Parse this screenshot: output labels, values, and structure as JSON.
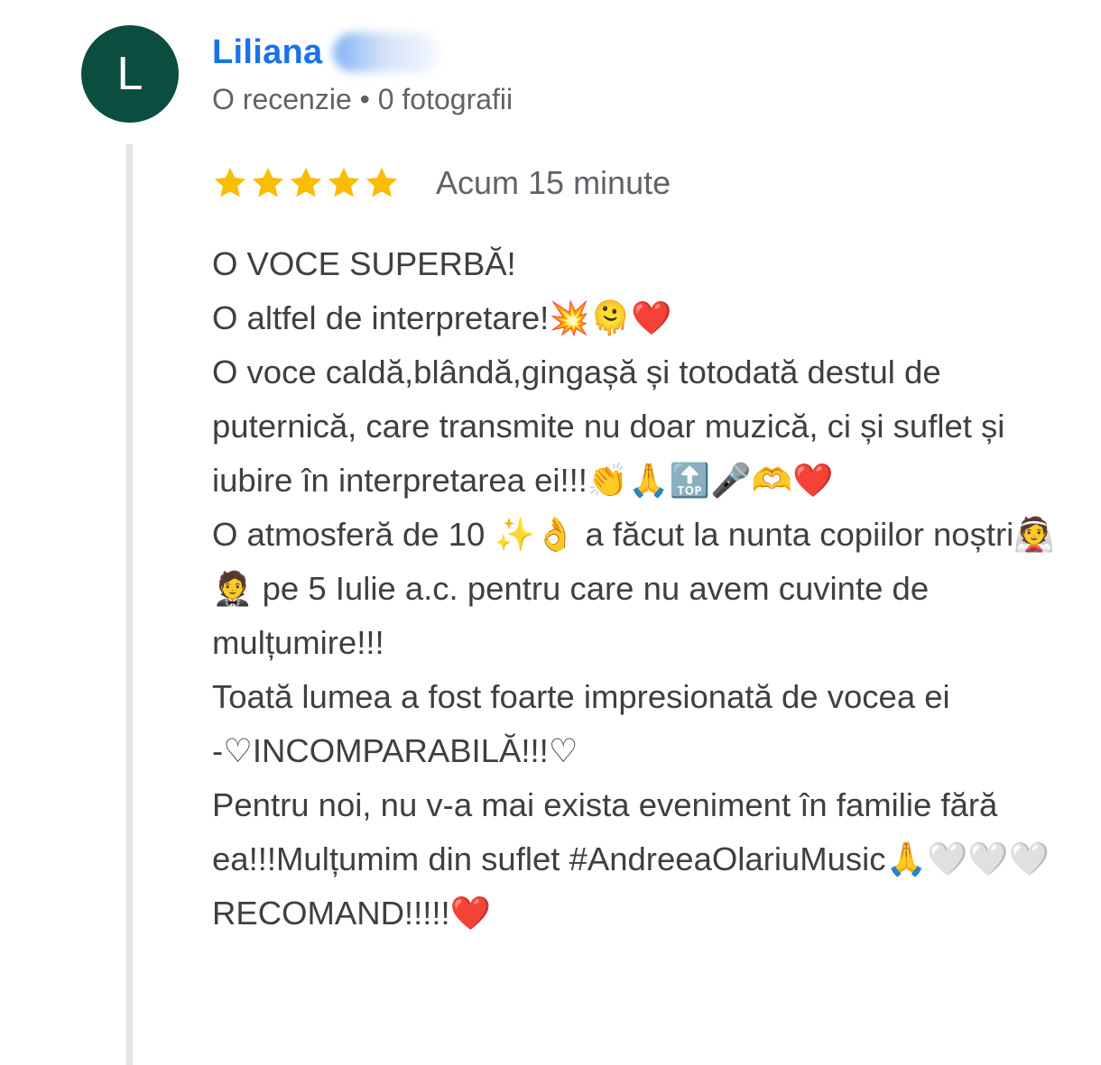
{
  "reviewer": {
    "avatar_letter": "L",
    "avatar_color": "#0b4d3e",
    "name": "Liliana",
    "name_color": "#1a73e8",
    "meta": "O recenzie • 0 fotografii"
  },
  "review": {
    "rating": 5,
    "max_rating": 5,
    "star_color": "#fbbc04",
    "time": "Acum 15 minute",
    "text": "O VOCE SUPERBĂ!\nO altfel de interpretare!💥🫠❤️\nO voce caldă,blândă,gingașă și totodată destul de puternică, care transmite nu doar muzică, ci și suflet și iubire în interpretarea ei!!!👏🙏🔝🎤🫶❤️\nO atmosferă de 10 ✨👌 a făcut la nunta copiilor noștri👰🤵 pe 5 Iulie a.c. pentru care nu avem cuvinte de mulțumire!!!\nToată lumea a fost foarte impresionată de vocea ei -♡INCOMPARABILĂ!!!♡\nPentru noi, nu v-a mai exista eveniment în familie fără ea!!!Mulțumim din suflet #AndreeaOlariuMusic🙏🤍🤍🤍\nRECOMAND!!!!!❤️"
  }
}
